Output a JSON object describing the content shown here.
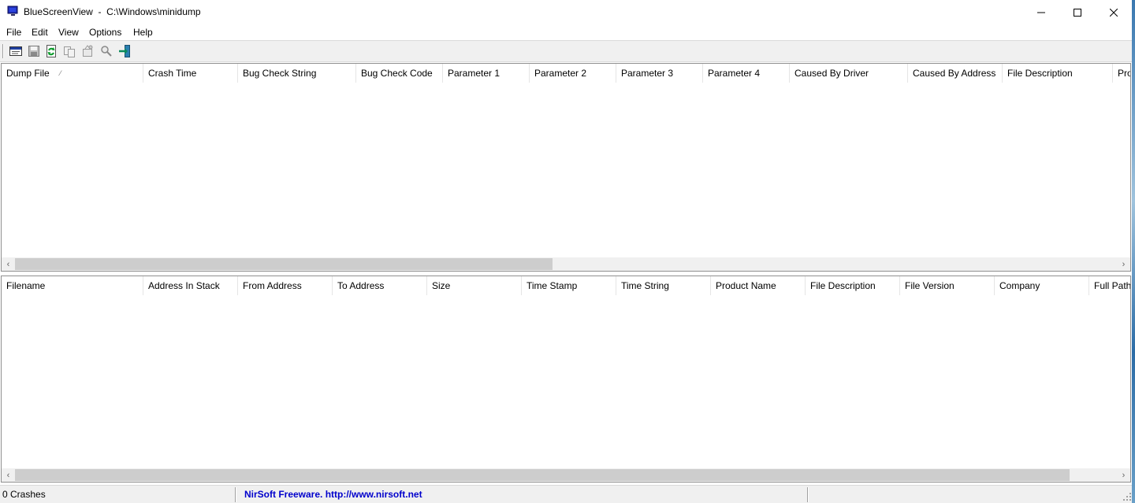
{
  "window": {
    "title": "BlueScreenView  -  C:\\Windows\\minidump",
    "controls": {
      "minimize_icon": "minimize-icon",
      "maximize_icon": "maximize-icon",
      "close_icon": "close-icon"
    }
  },
  "menu": {
    "items": [
      {
        "label": "File"
      },
      {
        "label": "Edit"
      },
      {
        "label": "View"
      },
      {
        "label": "Options"
      },
      {
        "label": "Help"
      }
    ]
  },
  "toolbar": {
    "buttons": [
      {
        "icon": "properties-icon"
      },
      {
        "icon": "save-icon"
      },
      {
        "icon": "refresh-icon"
      },
      {
        "icon": "copy-icon"
      },
      {
        "icon": "html-report-icon"
      },
      {
        "icon": "find-icon"
      },
      {
        "icon": "exit-icon"
      }
    ]
  },
  "crash_list": {
    "columns": [
      {
        "label": "Dump File",
        "sorted": true
      },
      {
        "label": "Crash Time"
      },
      {
        "label": "Bug Check String"
      },
      {
        "label": "Bug Check Code"
      },
      {
        "label": "Parameter 1"
      },
      {
        "label": "Parameter 2"
      },
      {
        "label": "Parameter 3"
      },
      {
        "label": "Parameter 4"
      },
      {
        "label": "Caused By Driver"
      },
      {
        "label": "Caused By Address"
      },
      {
        "label": "File Description"
      },
      {
        "label": "Pro"
      }
    ],
    "rows": [],
    "scrollbar": {
      "left_arrow": "‹",
      "right_arrow": "›"
    }
  },
  "driver_list": {
    "columns": [
      {
        "label": "Filename"
      },
      {
        "label": "Address In Stack"
      },
      {
        "label": "From Address"
      },
      {
        "label": "To Address"
      },
      {
        "label": "Size"
      },
      {
        "label": "Time Stamp"
      },
      {
        "label": "Time String"
      },
      {
        "label": "Product Name"
      },
      {
        "label": "File Description"
      },
      {
        "label": "File Version"
      },
      {
        "label": "Company"
      },
      {
        "label": "Full Path"
      }
    ],
    "rows": [],
    "scrollbar": {
      "left_arrow": "‹",
      "right_arrow": "›"
    }
  },
  "statusbar": {
    "crash_count": "0 Crashes",
    "link_text": "NirSoft Freeware.  http://www.nirsoft.net"
  },
  "colors": {
    "link": "#0000cc",
    "chrome": "#f0f0f0",
    "border": "#8f8f8f"
  }
}
